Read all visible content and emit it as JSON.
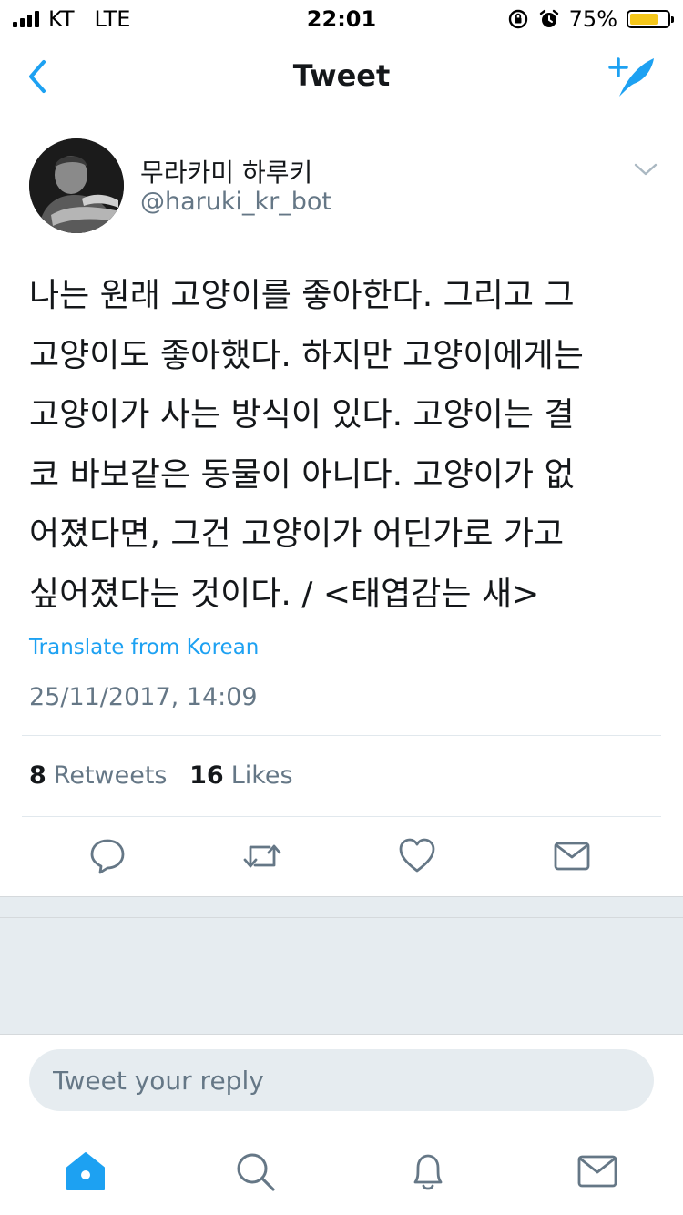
{
  "status_bar": {
    "carrier": "KT",
    "network": "LTE",
    "time": "22:01",
    "battery_percent": "75%",
    "battery_level": 0.75
  },
  "nav": {
    "title": "Tweet",
    "back_icon": "chevron-left-icon",
    "compose_icon": "compose-tweet-icon"
  },
  "tweet": {
    "author_name": "무라카미 하루키",
    "author_handle": "@haruki_kr_bot",
    "lines": [
      "나는 원래 고양이를 좋아한다. 그리고 그",
      "고양이도 좋아했다. 하지만 고양이에게는",
      "고양이가 사는 방식이 있다. 고양이는 결",
      "코 바보같은 동물이 아니다. 고양이가 없",
      "어졌다면, 그건 고양이가 어딘가로 가고",
      "싶어졌다는 것이다. / <태엽감는 새>"
    ],
    "translate_label": "Translate from Korean",
    "timestamp": "25/11/2017, 14:09",
    "retweets_count": "8",
    "retweets_label": "Retweets",
    "likes_count": "16",
    "likes_label": "Likes"
  },
  "reply": {
    "placeholder": "Tweet your reply"
  },
  "colors": {
    "accent": "#1da1f2",
    "secondary_text": "#657786",
    "divider": "#e1e8ed",
    "band": "#e6ecf0"
  }
}
